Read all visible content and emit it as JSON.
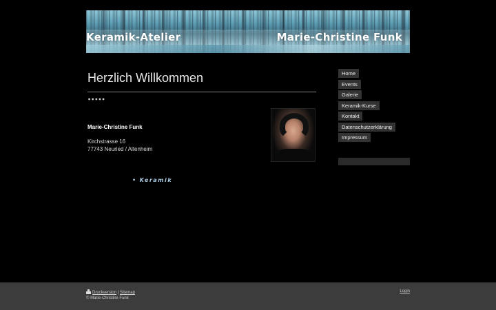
{
  "header": {
    "left_title": "Keramik-Atelier",
    "right_title": "Marie-Christine Funk"
  },
  "main": {
    "title": "Herzlich Willkommen",
    "dots": "•••••",
    "name": "Marie-Christine Funk",
    "address_line1": "Kirchstrasse 16",
    "address_line2": "77743  Neuried / Altenheim",
    "keramik_link": "Keramik",
    "bullet": "•"
  },
  "nav": {
    "items": [
      {
        "label": "Home"
      },
      {
        "label": "Events"
      },
      {
        "label": "Galerie"
      },
      {
        "label": "Keramik-Kurse"
      },
      {
        "label": "Kontakt"
      },
      {
        "label": "Datenschutzerklärung"
      },
      {
        "label": "Impressum"
      }
    ]
  },
  "footer": {
    "print_label": "Druckversion",
    "separator": " | ",
    "sitemap_label": "Sitemap",
    "copyright": "© Marie-Christine Funk",
    "login_label": "Login"
  },
  "colors": {
    "background": "#000000",
    "nav_bg": "#333333",
    "footer_bg": "#3c3c3c",
    "link_accent": "#a8c8e0"
  }
}
